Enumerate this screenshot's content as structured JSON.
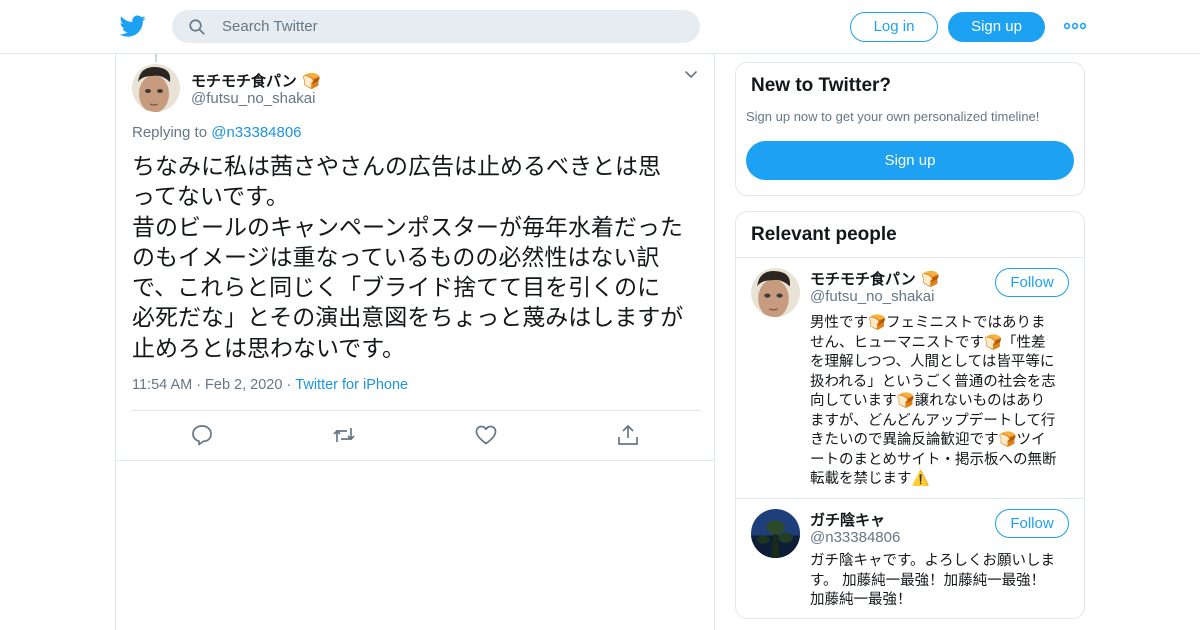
{
  "header": {
    "search_placeholder": "Search Twitter",
    "login_label": "Log in",
    "signup_label": "Sign up",
    "brand_color": "#1da1f2"
  },
  "tweet": {
    "author_name": "モチモチ食パン",
    "author_handle": "@futsu_no_shakai",
    "replying_label": "Replying to",
    "replying_handle": "@n33384806",
    "text": "ちなみに私は茜さやさんの広告は止めるべきとは思\nってないです。\n昔のビールのキャンペーンポスターが毎年水着だった\nのもイメージは重なっているものの必然性はない訳\nで、これらと同じく「ブライド捨てて目を引くのに\n必死だな」とその演出意図をちょっと蔑みはしますが\n止めろとは思わないです。",
    "time": "11:54 AM",
    "date": "Feb 2, 2020",
    "source": "Twitter for iPhone"
  },
  "sidebar": {
    "new_title": "New to Twitter?",
    "new_sub": "Sign up now to get your own personalized timeline!",
    "new_button": "Sign up",
    "relevant_title": "Relevant people",
    "people": [
      {
        "name": "モチモチ食パン",
        "handle": "@futsu_no_shakai",
        "follow_label": "Follow",
        "bio": "男性です🍞フェミニストではありま\nせん、ヒューマニストです🍞「性差\nを理解しつつ、人間としては皆平等に\n扱われる」というごく普通の社会を志\n向しています🍞譲れないものはあり\nますが、どんどんアップデートして行\nきたいので異論反論歓迎です🍞ツイ\nートのまとめサイト・掲示板への無断\n転載を禁じます⚠️"
      },
      {
        "name": "ガチ陰キャ",
        "handle": "@n33384806",
        "follow_label": "Follow",
        "bio": "ガチ陰キャです。よろしくお願いしま\nす。 加藤純一最強！加藤純一最強！\n加藤純一最強！"
      }
    ]
  },
  "icons": {
    "logo": "twitter-bird-icon",
    "search": "search-icon",
    "more": "more-dots-icon",
    "caret": "chevron-down-icon",
    "reply": "reply-icon",
    "retweet": "retweet-icon",
    "like": "heart-icon",
    "share": "share-icon"
  }
}
